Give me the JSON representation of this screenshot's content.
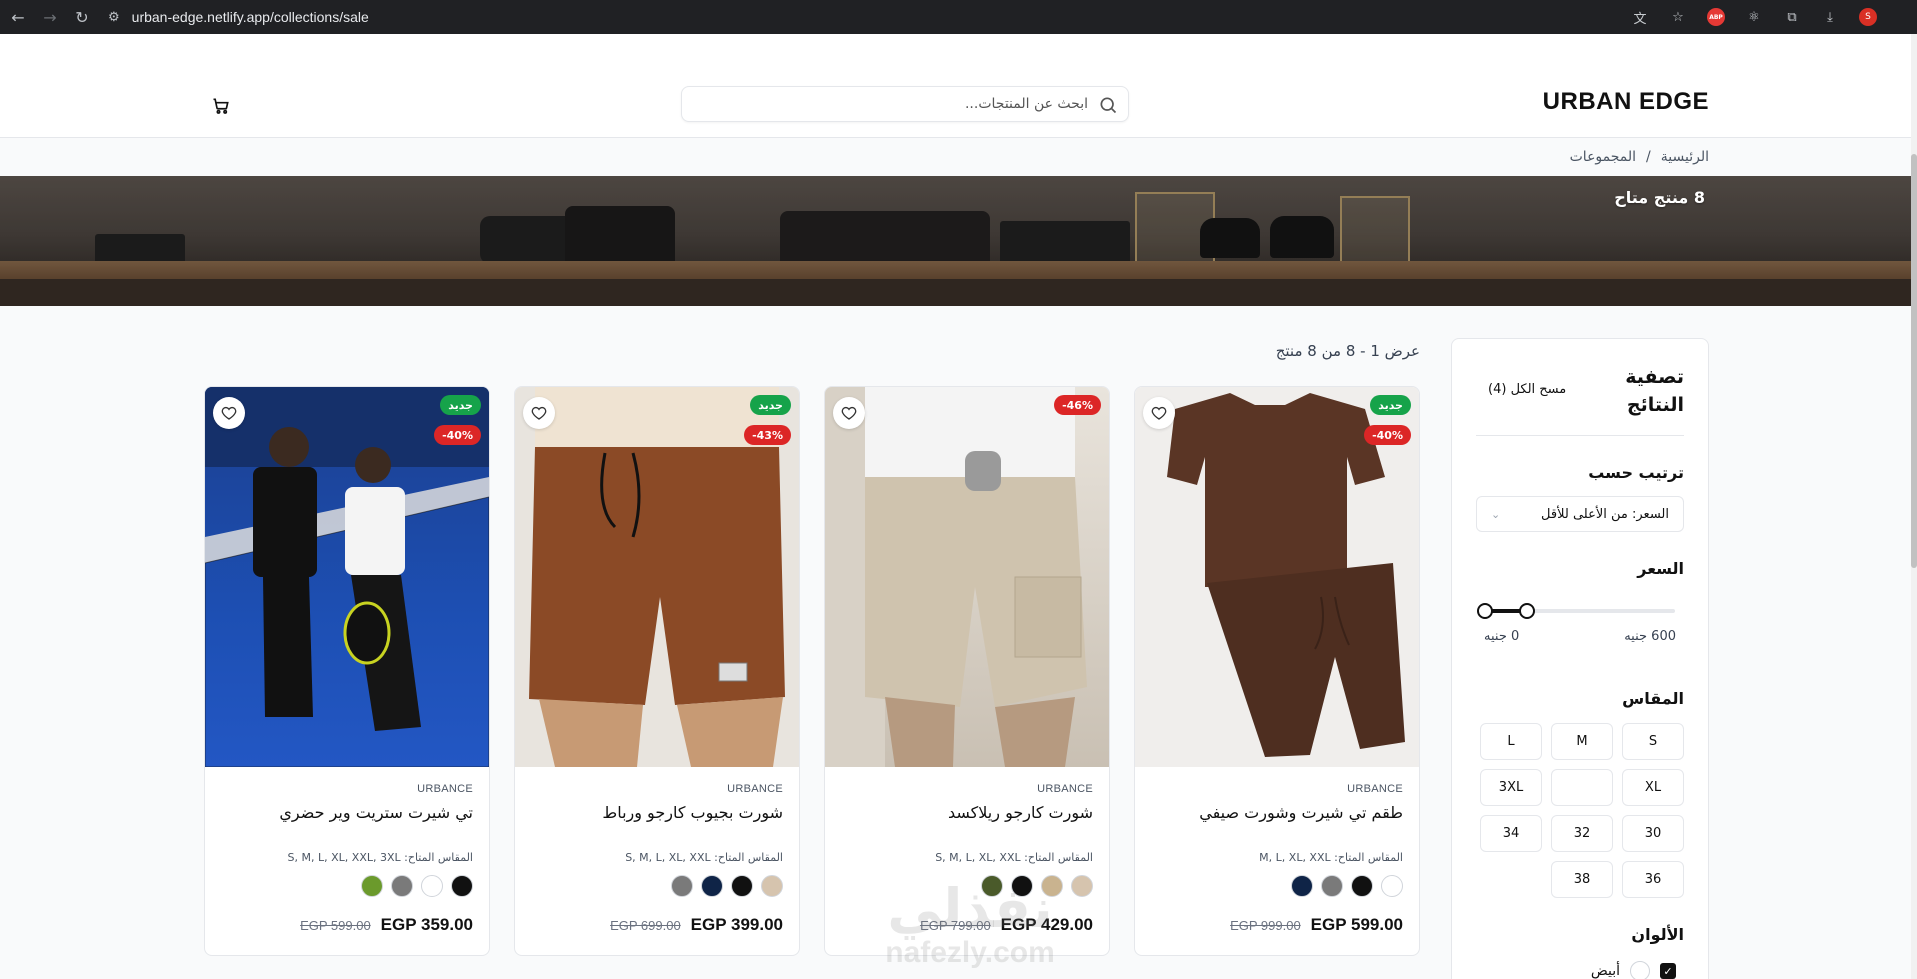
{
  "browser": {
    "url": "urban-edge.netlify.app/collections/sale",
    "back_icon": "back-arrow-icon",
    "forward_icon": "forward-arrow-icon",
    "reload_icon": "reload-icon"
  },
  "header": {
    "logo": "URBAN EDGE",
    "search_placeholder": "ابحث عن المنتجات..."
  },
  "breadcrumb": {
    "home": "الرئيسية",
    "separator": "/",
    "current": "المجموعات"
  },
  "hero": {
    "count_text": "8 منتج متاح"
  },
  "results": {
    "text": "عرض 1 - 8 من 8 منتج"
  },
  "filters": {
    "title": "تصفية النتائج",
    "clear_label": "مسح الكل (4)",
    "sort_label": "ترتيب حسب",
    "sort_value": "السعر: من الأعلى للأقل",
    "price_label": "السعر",
    "price_min_label": "0 جنيه",
    "price_max_label": "600 جنيه",
    "price_range_fraction": [
      0,
      0.22
    ],
    "size_label": "المقاس",
    "sizes": [
      "S",
      "M",
      "L",
      "XL",
      "",
      "3XL",
      "30",
      "32",
      "34",
      "36",
      "38"
    ],
    "colors_label": "الألوان",
    "color_white": "أبيض",
    "color_white_checked": true
  },
  "products": [
    {
      "name": "طقم تي شيرت وشورت صيفي",
      "brand": "URBANCE",
      "badges": [
        "جديد",
        "40%-"
      ],
      "sizes": "المقاس المتاح: M, L, XL, XXL",
      "swatches": [
        "#ffffff",
        "#111111",
        "#7a7a7a",
        "#0f2447"
      ],
      "price": "EGP 599.00",
      "old_price": "EGP 999.00"
    },
    {
      "name": "شورت كارجو ريلاكسد",
      "brand": "URBANCE",
      "badges": [
        "46%-"
      ],
      "sizes": "المقاس المتاح: S, M, L, XL, XXL",
      "swatches": [
        "#d6c4ae",
        "#c9b38f",
        "#111111",
        "#4a5a2a"
      ],
      "price": "EGP 429.00",
      "old_price": "EGP 799.00"
    },
    {
      "name": "شورت بجيوب كارجو ورباط",
      "brand": "URBANCE",
      "badges": [
        "جديد",
        "43%-"
      ],
      "sizes": "المقاس المتاح: S, M, L, XL, XXL",
      "swatches": [
        "#d6c4ae",
        "#111111",
        "#0f2447",
        "#7a7a7a"
      ],
      "price": "EGP 399.00",
      "old_price": "EGP 699.00"
    },
    {
      "name": "تي شيرت ستريت وير حضري",
      "brand": "URBANCE",
      "badges": [
        "جديد",
        "40%-"
      ],
      "sizes": "المقاس المتاح: S, M, L, XL, XXL, 3XL",
      "swatches": [
        "#111111",
        "#ffffff",
        "#7a7a7a",
        "#6b9a2c"
      ],
      "price": "EGP 359.00",
      "old_price": "EGP 599.00"
    }
  ],
  "watermark": {
    "arabic": "نفذلي",
    "latin": "nafezly.com"
  }
}
